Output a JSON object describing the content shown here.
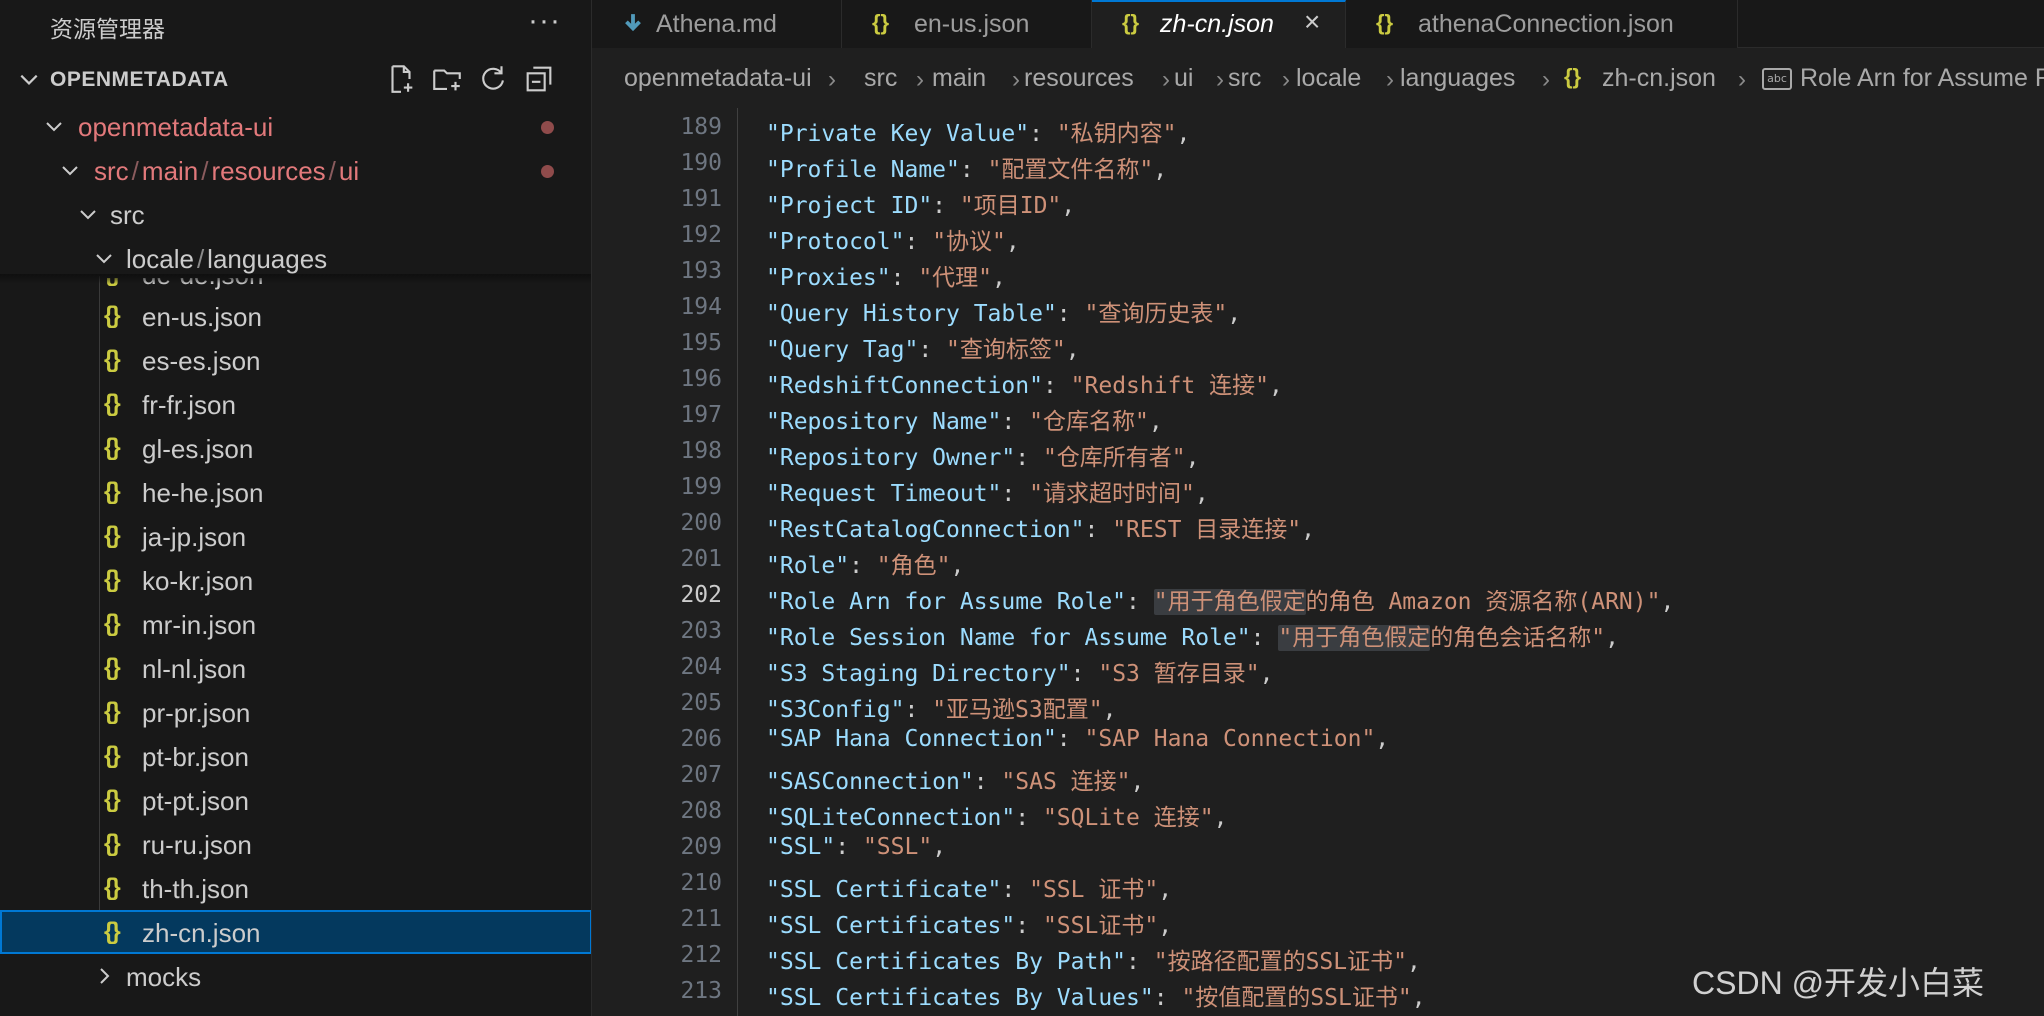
{
  "sidebar": {
    "title": "资源管理器",
    "more": "···",
    "section_title": "OPENMETADATA",
    "tree": [
      {
        "label": "openmetadata-ui",
        "modified": true
      },
      {
        "label": "src/main/resources/ui",
        "segments": [
          "src",
          "main",
          "resources",
          "ui"
        ],
        "modified": true
      },
      {
        "label": "src",
        "modified": false
      },
      {
        "label": "locale/languages",
        "segments": [
          "locale",
          "languages"
        ],
        "modified": false
      }
    ],
    "files_partial": "de-de.json",
    "files": [
      "en-us.json",
      "es-es.json",
      "fr-fr.json",
      "gl-es.json",
      "he-he.json",
      "ja-jp.json",
      "ko-kr.json",
      "mr-in.json",
      "nl-nl.json",
      "pr-pr.json",
      "pt-br.json",
      "pt-pt.json",
      "ru-ru.json",
      "th-th.json",
      "zh-cn.json"
    ],
    "selected_file": "zh-cn.json",
    "after_folder": "mocks",
    "json_icon": "{}"
  },
  "tabs": [
    {
      "label": "Athena.md",
      "icon": "markdown-icon",
      "active": false
    },
    {
      "label": "en-us.json",
      "icon": "json-icon",
      "active": false
    },
    {
      "label": "zh-cn.json",
      "icon": "json-icon",
      "active": true
    },
    {
      "label": "athenaConnection.json",
      "icon": "json-icon",
      "active": false
    }
  ],
  "tab_close": "×",
  "breadcrumb": [
    "openmetadata-ui",
    "src",
    "main",
    "resources",
    "ui",
    "src",
    "locale",
    "languages",
    "zh-cn.json",
    "Role Arn for Assume Role"
  ],
  "breadcrumb_sep": "›",
  "editor": {
    "current_line": 202,
    "lines": [
      {
        "n": 189,
        "key": "\"Private Key Value\"",
        "value": "\"私钥内容\""
      },
      {
        "n": 190,
        "key": "\"Profile Name\"",
        "value": "\"配置文件名称\""
      },
      {
        "n": 191,
        "key": "\"Project ID\"",
        "value": "\"项目ID\""
      },
      {
        "n": 192,
        "key": "\"Protocol\"",
        "value": "\"协议\""
      },
      {
        "n": 193,
        "key": "\"Proxies\"",
        "value": "\"代理\""
      },
      {
        "n": 194,
        "key": "\"Query History Table\"",
        "value": "\"查询历史表\""
      },
      {
        "n": 195,
        "key": "\"Query Tag\"",
        "value": "\"查询标签\""
      },
      {
        "n": 196,
        "key": "\"RedshiftConnection\"",
        "value": "\"Redshift 连接\""
      },
      {
        "n": 197,
        "key": "\"Repository Name\"",
        "value": "\"仓库名称\""
      },
      {
        "n": 198,
        "key": "\"Repository Owner\"",
        "value": "\"仓库所有者\""
      },
      {
        "n": 199,
        "key": "\"Request Timeout\"",
        "value": "\"请求超时时间\""
      },
      {
        "n": 200,
        "key": "\"RestCatalogConnection\"",
        "value": "\"REST 目录连接\""
      },
      {
        "n": 201,
        "key": "\"Role\"",
        "value": "\"角色\""
      },
      {
        "n": 202,
        "key": "\"Role Arn for Assume Role\"",
        "value_hl": "\"用于角色假定",
        "value": "的角色 Amazon 资源名称(ARN)\""
      },
      {
        "n": 203,
        "key": "\"Role Session Name for Assume Role\"",
        "value_hl": "\"用于角色假定",
        "value": "的角色会话名称\""
      },
      {
        "n": 204,
        "key": "\"S3 Staging Directory\"",
        "value": "\"S3 暂存目录\""
      },
      {
        "n": 205,
        "key": "\"S3Config\"",
        "value": "\"亚马逊S3配置\""
      },
      {
        "n": 206,
        "key": "\"SAP Hana Connection\"",
        "value": "\"SAP Hana Connection\""
      },
      {
        "n": 207,
        "key": "\"SASConnection\"",
        "value": "\"SAS 连接\""
      },
      {
        "n": 208,
        "key": "\"SQLiteConnection\"",
        "value": "\"SQLite 连接\""
      },
      {
        "n": 209,
        "key": "\"SSL\"",
        "value": "\"SSL\""
      },
      {
        "n": 210,
        "key": "\"SSL Certificate\"",
        "value": "\"SSL 证书\""
      },
      {
        "n": 211,
        "key": "\"SSL Certificates\"",
        "value": "\"SSL证书\""
      },
      {
        "n": 212,
        "key": "\"SSL Certificates By Path\"",
        "value": "\"按路径配置的SSL证书\""
      },
      {
        "n": 213,
        "key": "\"SSL Certificates By Values\"",
        "value": "\"按值配置的SSL证书\""
      }
    ]
  },
  "watermark": "CSDN @开发小白菜",
  "colors": {
    "accent": "#0078d4",
    "json_icon": "#cbcb41",
    "modified": "#e2797b",
    "string": "#ce9178",
    "key": "#9cdcfe"
  }
}
